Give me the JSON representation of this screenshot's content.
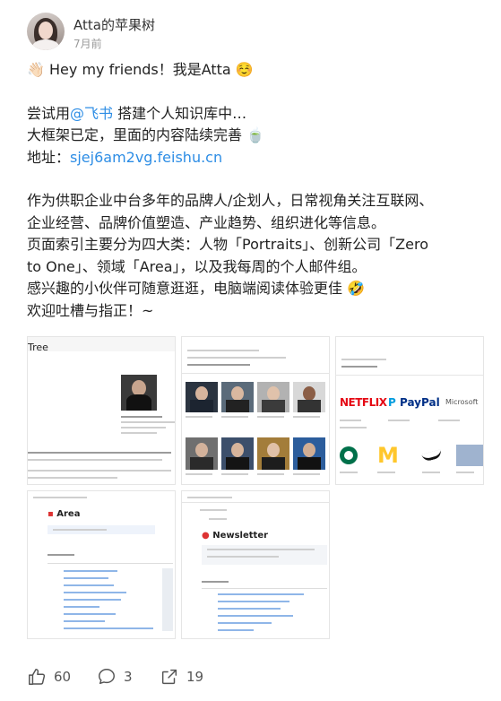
{
  "author": {
    "name": "Atta的苹果树",
    "time": "7月前"
  },
  "post": {
    "line1_emoji": "👋🏻",
    "line1_text": "Hey my friends！我是Atta",
    "line1_emoji2": "☺️",
    "line2_prefix": "尝试用",
    "line2_mention": "@飞书",
    "line2_suffix": " 搭建个人知识库中…",
    "line3_text": "大框架已定，里面的内容陆续完善",
    "line3_emoji": "🍵",
    "line4_prefix": "地址：",
    "line4_link": "sjej6am2vg.feishu.cn",
    "p2_line1": "作为供职企业中台多年的品牌人/企划人，日常视角关注互联网、",
    "p2_line2": "企业经营、品牌价值塑造、产业趋势、组织进化等信息。",
    "p2_line3": "页面索引主要分为四大类：人物「Portraits」、创新公司「Zero",
    "p2_line4": "to One」、领域「Area」，以及我每周的个人邮件组。",
    "p2_line5_text": "感兴趣的小伙伴可随意逛逛，电脑端阅读体验更佳",
    "p2_line5_emoji": "🤣",
    "p2_line6": "欢迎吐槽与指正！~"
  },
  "images": {
    "img1": {
      "title": "Tree"
    },
    "img3": {
      "logo1": "NETFLIX",
      "logo2": "PayPal",
      "logo3": "Microsoft",
      "logo5": "M"
    },
    "img4": {
      "title": "Area"
    },
    "img5": {
      "title": "Newsletter"
    }
  },
  "actions": {
    "likes": "60",
    "comments": "3",
    "shares": "19"
  },
  "colors": {
    "link": "#2d8de5",
    "netflix": "#e50914",
    "paypal_dark": "#003087",
    "paypal_light": "#009cde",
    "mcdonalds": "#ffc72c",
    "starbucks": "#00704a"
  }
}
